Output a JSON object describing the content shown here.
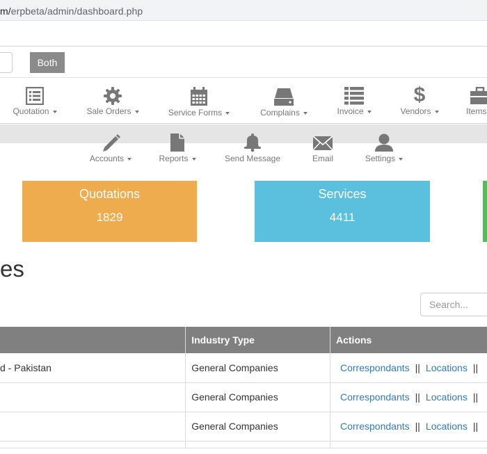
{
  "browser": {
    "url_prefix": "m/",
    "url_rest": "erpbeta/admin/dashboard.php"
  },
  "filter": {
    "both_label": "Both"
  },
  "nav_primary": [
    {
      "label": "Quotation",
      "icon": "list-alt-icon"
    },
    {
      "label": "Sale Orders",
      "icon": "cog-icon"
    },
    {
      "label": "Service Forms",
      "icon": "calendar-icon"
    },
    {
      "label": "Complains",
      "icon": "hdd-icon"
    },
    {
      "label": "Invoice",
      "icon": "th-list-icon"
    },
    {
      "label": "Vendors",
      "icon": "dollar-icon"
    },
    {
      "label": "Items",
      "icon": "briefcase-icon"
    }
  ],
  "nav_secondary": [
    {
      "label": "Accounts",
      "icon": "pencil-icon"
    },
    {
      "label": "Reports",
      "icon": "file-icon"
    },
    {
      "label": "Send Message",
      "icon": "bell-icon"
    },
    {
      "label": "Email",
      "icon": "envelope-icon"
    },
    {
      "label": "Settings",
      "icon": "user-icon"
    }
  ],
  "cards": [
    {
      "title": "Quotations",
      "value": "1829",
      "color": "#efac4e"
    },
    {
      "title": "Services",
      "value": "4411",
      "color": "#5bc0de"
    }
  ],
  "section": {
    "heading": "es"
  },
  "search": {
    "placeholder": "Search..."
  },
  "table": {
    "headers": [
      "",
      "Industry Type",
      "Actions"
    ],
    "rows": [
      {
        "name": "d - Pakistan",
        "industry": "General Companies"
      },
      {
        "name": "",
        "industry": "General Companies"
      },
      {
        "name": "",
        "industry": "General Companies"
      }
    ],
    "actions": {
      "correspondants": "Correspondants",
      "locations": "Locations",
      "separator": "||"
    }
  }
}
